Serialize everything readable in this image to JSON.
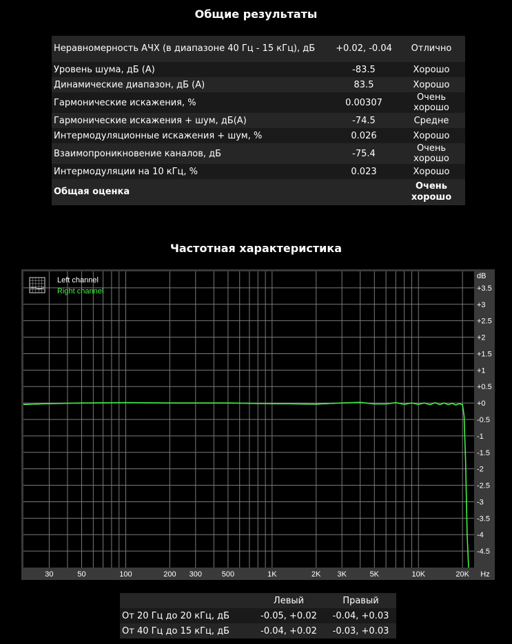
{
  "results": {
    "title": "Общие результаты",
    "rows": [
      {
        "name": "Неравномерность АЧХ (в диапазоне 40 Гц - 15 кГц), дБ",
        "value": "+0.02, -0.04",
        "grade": "Отлично"
      },
      {
        "name": "Уровень шума, дБ (А)",
        "value": "-83.5",
        "grade": "Хорошо"
      },
      {
        "name": "Динамические диапазон, дБ (А)",
        "value": "83.5",
        "grade": "Хорошо"
      },
      {
        "name": "Гармонические искажения, %",
        "value": "0.00307",
        "grade": "Очень хорошо"
      },
      {
        "name": "Гармонические искажения + шум, дБ(A)",
        "value": "-74.5",
        "grade": "Средне"
      },
      {
        "name": "Интермодуляционные искажения + шум, %",
        "value": "0.026",
        "grade": "Хорошо"
      },
      {
        "name": "Взаимопроникновение каналов, дБ",
        "value": "-75.4",
        "grade": "Очень хорошо"
      },
      {
        "name": "Интермодуляции на 10 кГц, %",
        "value": "0.023",
        "grade": "Хорошо"
      }
    ],
    "total": {
      "name": "Общая оценка",
      "grade": "Очень хорошо"
    }
  },
  "chart_title": "Частотная характеристика",
  "chart_data": {
    "type": "line",
    "xscale": "log",
    "xlim": [
      20,
      24000
    ],
    "ylim": [
      -5,
      4
    ],
    "x_tick_labels": [
      {
        "x": 30,
        "label": "30"
      },
      {
        "x": 50,
        "label": "50"
      },
      {
        "x": 100,
        "label": "100"
      },
      {
        "x": 200,
        "label": "200"
      },
      {
        "x": 300,
        "label": "300"
      },
      {
        "x": 500,
        "label": "500"
      },
      {
        "x": 1000,
        "label": "1K"
      },
      {
        "x": 2000,
        "label": "2K"
      },
      {
        "x": 3000,
        "label": "3K"
      },
      {
        "x": 5000,
        "label": "5K"
      },
      {
        "x": 10000,
        "label": "10K"
      },
      {
        "x": 20000,
        "label": "20K"
      }
    ],
    "x_unit": "Hz",
    "y_unit": "dB",
    "y_tick_labels": [
      {
        "y": 3.5,
        "label": "+3.5"
      },
      {
        "y": 3,
        "label": "+3"
      },
      {
        "y": 2.5,
        "label": "+2.5"
      },
      {
        "y": 2,
        "label": "+2"
      },
      {
        "y": 1.5,
        "label": "+1.5"
      },
      {
        "y": 1,
        "label": "+1"
      },
      {
        "y": 0.5,
        "label": "+0.5"
      },
      {
        "y": 0,
        "label": "+0"
      },
      {
        "y": -0.5,
        "label": "-0.5"
      },
      {
        "y": -1,
        "label": "-1"
      },
      {
        "y": -1.5,
        "label": "-1.5"
      },
      {
        "y": -2,
        "label": "-2"
      },
      {
        "y": -2.5,
        "label": "-2.5"
      },
      {
        "y": -3,
        "label": "-3"
      },
      {
        "y": -3.5,
        "label": "-3.5"
      },
      {
        "y": -4,
        "label": "-4"
      },
      {
        "y": -4.5,
        "label": "-4.5"
      }
    ],
    "grid": true,
    "legend_position": "top-left",
    "series": [
      {
        "name": "Left channel",
        "color": "#ffffff",
        "points": [
          [
            20,
            -0.05
          ],
          [
            30,
            -0.02
          ],
          [
            50,
            0.0
          ],
          [
            100,
            0.01
          ],
          [
            200,
            0.0
          ],
          [
            500,
            0.0
          ],
          [
            1000,
            -0.02
          ],
          [
            2000,
            -0.04
          ],
          [
            3000,
            0.0
          ],
          [
            4000,
            0.02
          ],
          [
            5000,
            -0.03
          ],
          [
            6000,
            -0.03
          ],
          [
            7000,
            0.01
          ],
          [
            8000,
            -0.04
          ],
          [
            9000,
            0.0
          ],
          [
            10000,
            -0.04
          ],
          [
            11000,
            0.0
          ],
          [
            12000,
            -0.05
          ],
          [
            13000,
            0.01
          ],
          [
            14000,
            -0.05
          ],
          [
            15000,
            0.0
          ],
          [
            16000,
            -0.05
          ],
          [
            17000,
            -0.01
          ],
          [
            18000,
            -0.06
          ],
          [
            19000,
            -0.02
          ],
          [
            20000,
            -0.05
          ],
          [
            20500,
            -0.4
          ],
          [
            21000,
            -1.8
          ],
          [
            21500,
            -4.0
          ],
          [
            22000,
            -5.0
          ]
        ]
      },
      {
        "name": "Right channel",
        "color": "#44ee44",
        "points": [
          [
            20,
            -0.04
          ],
          [
            30,
            -0.02
          ],
          [
            50,
            0.0
          ],
          [
            100,
            0.01
          ],
          [
            200,
            0.0
          ],
          [
            500,
            0.0
          ],
          [
            1000,
            -0.02
          ],
          [
            2000,
            -0.03
          ],
          [
            3000,
            0.0
          ],
          [
            4000,
            0.02
          ],
          [
            5000,
            -0.03
          ],
          [
            6000,
            -0.03
          ],
          [
            7000,
            0.01
          ],
          [
            8000,
            -0.04
          ],
          [
            9000,
            0.0
          ],
          [
            10000,
            -0.04
          ],
          [
            11000,
            0.0
          ],
          [
            12000,
            -0.05
          ],
          [
            13000,
            0.01
          ],
          [
            14000,
            -0.05
          ],
          [
            15000,
            0.0
          ],
          [
            16000,
            -0.05
          ],
          [
            17000,
            -0.01
          ],
          [
            18000,
            -0.06
          ],
          [
            19000,
            -0.02
          ],
          [
            20000,
            -0.05
          ],
          [
            20500,
            -0.4
          ],
          [
            21000,
            -1.8
          ],
          [
            21500,
            -4.0
          ],
          [
            22000,
            -5.0
          ]
        ]
      }
    ]
  },
  "summary": {
    "headers": [
      "",
      "Левый",
      "Правый"
    ],
    "rows": [
      [
        "От 20 Гц до 20 кГц, дБ",
        "-0.05, +0.02",
        "-0.04, +0.03"
      ],
      [
        "От 40 Гц до 15 кГц, дБ",
        "-0.04, +0.02",
        "-0.03, +0.03"
      ]
    ]
  }
}
